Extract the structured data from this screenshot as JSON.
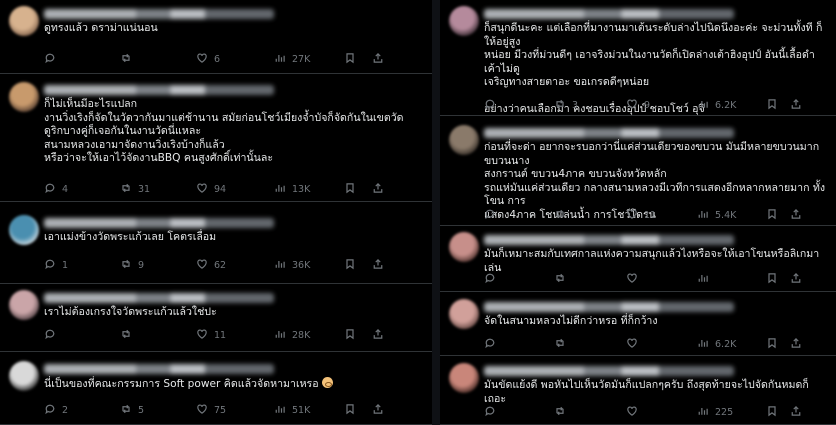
{
  "left_column": [
    {
      "text": "ดูทรงแล้ว ดราม่าแน่นอน",
      "replies": "",
      "reposts": "",
      "likes": "6",
      "views": "27K",
      "avatar_colors": [
        "#d7b28e",
        "#8a6a52"
      ]
    },
    {
      "text": "ก็ไม่เห็นมีอะไรแปลก\nงานวิ่งเริงก็จัดในวัดวากันมาแต่ช้านาน สมัยก่อนโชว์เมียงจ้ำบัจก็จัดกันในเขตวัด\nดูริกบางคู่ก็เจอกันในงานวัดนี่แหละ\nสนามหลวงเอามาจัดงานวิ่งเริงบ้างก็แล้ว\nหรือว่าจะให้เอาไว้จัดงานBBQ คนสูงศักดิ์เท่านั้นละ",
      "replies": "4",
      "reposts": "31",
      "likes": "94",
      "views": "13K",
      "avatar_colors": [
        "#c89a6c",
        "#5a4232"
      ]
    },
    {
      "text": "เอาแม่งข้างวัดพระแก้วเลย โคตรเลื่อม",
      "replies": "1",
      "reposts": "9",
      "likes": "62",
      "views": "36K",
      "avatar_colors": [
        "#4a8fb0",
        "#c9d6dd"
      ]
    },
    {
      "text": "เราไม่ต้องเกรงใจวัดพระแก้วแล้วใช่ปะ",
      "replies": "",
      "reposts": "",
      "likes": "11",
      "views": "28K",
      "avatar_colors": [
        "#caa5a8",
        "#5c4a4d"
      ]
    },
    {
      "text": "นี่เป็นของที่คณะกรรมการ Soft power คิดแล้วจัดหามาเหรอ",
      "replies": "2",
      "reposts": "5",
      "likes": "75",
      "views": "51K",
      "avatar_colors": [
        "#d9d9d9",
        "#303030"
      ]
    }
  ],
  "right_column": [
    {
      "text": "ก็สนุกดีนะคะ แต่เลือกที่มางานมาเต้นระดับล่างไปนิดนึงอะค่ะ จะม่วนทั้งที ก็ให้อยู่สูง\nหน่อย มีวงที่ม่วนดีๆ เอาจริงม่วนในงานวัดก็เปิดล่างเต้าฮิงอุปป์ อันนี้เลื้อดำเค้าไม่ดู\nเจริญทางสายตาอะ ขอเกรดดีๆหน่อย\n\nอย่างว่าคนเลือกมา คงชอบเรื่องอุปป์ ชอบโชว์ อุจิ",
      "replies": "",
      "reposts": "3",
      "likes": "9",
      "views": "6.2K",
      "avatar_colors": [
        "#b58a9c",
        "#3e2f36"
      ]
    },
    {
      "text": "ก่อนที่จะด่า อยากจะรบอกว่านี่แค่ส่วนเดียวของขบวน มันมีหลายขบวนมาก ขบวนนาง\nสงกรานต์ ขบวน4ภาค ขบวนจังหวัดหลัก\nรถแห่มันแค่ส่วนเดียว กลางสนามหลวงมีเวทีการแสดงอีกหลากหลายมาก ทั้งโขน การ\nแสดง4ภาค โชนเล่นน้ำ การโชว์โดรน",
      "replies": "",
      "reposts": "",
      "likes": "11",
      "views": "5.4K",
      "avatar_colors": [
        "#8a7a6a",
        "#3b332c"
      ]
    },
    {
      "text": "มันก็เหมาะสมกับเทศกาลแห่งความสนุกแล้วไงหรือจะให้เอาโขนหรือลิเกมาเล่น",
      "replies": "",
      "reposts": "",
      "likes": "",
      "views": "",
      "avatar_colors": [
        "#c78f8a",
        "#573833"
      ]
    },
    {
      "text": "จัดในสนามหลวงไม่ดีกว่าหรอ ที่ก็กว้าง",
      "replies": "",
      "reposts": "",
      "likes": "",
      "views": "6.2K",
      "avatar_colors": [
        "#d1a09a",
        "#6b4d48"
      ]
    },
    {
      "text": "มันขัดแย้งดี พอหันไปเห็นวัดมันก็แปลกๆครับ ถึงสุดท้ายจะไปจัดกันหมดก็เถอะ",
      "replies": "",
      "reposts": "",
      "likes": "",
      "views": "225",
      "avatar_colors": [
        "#c9867a",
        "#4c2e28"
      ]
    }
  ]
}
